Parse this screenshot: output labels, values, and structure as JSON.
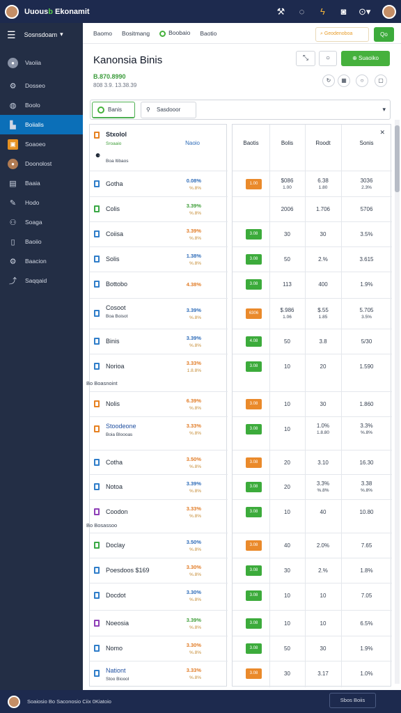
{
  "topbar": {
    "brand_prefix": "Uuous",
    "brand_accent": "b",
    "brand_rest": " Ekonamit"
  },
  "sidebar": {
    "header": "Sosnsdoam",
    "items": [
      {
        "label": "Vaoiia",
        "icon": "avatar-icon"
      },
      {
        "label": "Dosseo",
        "icon": "tools-icon"
      },
      {
        "label": "Boolo",
        "icon": "globe-icon"
      },
      {
        "label": "Boiialis",
        "icon": "chart-icon"
      },
      {
        "label": "Soaoeo",
        "icon": "box-icon"
      },
      {
        "label": "Doonolost",
        "icon": "person-icon"
      },
      {
        "label": "Baaia",
        "icon": "document-icon"
      },
      {
        "label": "Hodo",
        "icon": "pen-icon"
      },
      {
        "label": "Soaga",
        "icon": "users-icon"
      },
      {
        "label": "Baoiio",
        "icon": "copy-icon"
      },
      {
        "label": "Baacion",
        "icon": "settings-icon"
      },
      {
        "label": "Saqqaid",
        "icon": "share-icon"
      }
    ]
  },
  "main": {
    "tabs": [
      "Baomo",
      "Bositmang",
      "Boobaio",
      "Baotio"
    ],
    "search": "Geodenoboa",
    "go": "Qo",
    "title": "Kanonsia Binis",
    "sub1": "B.870.8990",
    "sub2": "808 3.9. 13.38.39",
    "add_label": "Suaoiko",
    "filters": [
      "Banis",
      "Sasdooor"
    ]
  },
  "left_panel": {
    "header_title": "Stxolol",
    "header_sub": "Sroaaio",
    "header_note": "Boa Itibaos",
    "header_col": "Naoio",
    "rows": [
      {
        "name": "Gotha",
        "p1": "0.08%",
        "p2": "%.8%"
      },
      {
        "name": "Colis",
        "p1": "3.39%",
        "p2": "%.8%"
      },
      {
        "name": "Coiisa",
        "p1": "3.39%",
        "p2": "%.8%"
      },
      {
        "name": "Solis",
        "p1": "1.38%",
        "p2": "%.8%"
      },
      {
        "name": "Bottobo",
        "p1": "4.38%",
        "p2": ""
      },
      {
        "name": "Cosoot",
        "sub": "Boa Boisot",
        "p1": "3.39%",
        "p2": "%.8%"
      },
      {
        "name": "Binis",
        "p1": "3.39%",
        "p2": "%.8%"
      },
      {
        "name": "Norioa",
        "p1": "3.33%",
        "p2": "1.8.8%"
      },
      {
        "name": "Nolis",
        "p1": "6.39%",
        "p2": "%.8%"
      },
      {
        "name": "Stoodeone",
        "sub": "Boia Bloooas",
        "p1": "3.33%",
        "p2": "%.8%"
      },
      {
        "name": "Cotha",
        "p1": "3.50%",
        "p2": "%.8%"
      },
      {
        "name": "Notoa",
        "p1": "3.39%",
        "p2": "%.8%"
      },
      {
        "name": "Coodon",
        "p1": "3.33%",
        "p2": "%.8%"
      },
      {
        "name": "Doclay",
        "p1": "3.50%",
        "p2": "%.8%"
      },
      {
        "name": "Poesdoos $169",
        "p1": "3.30%",
        "p2": "%.8%"
      },
      {
        "name": "Docdot",
        "p1": "3.30%",
        "p2": "%.8%"
      },
      {
        "name": "Noeosia",
        "p1": "3.39%",
        "p2": "%.8%"
      },
      {
        "name": "Nomo",
        "p1": "3.30%",
        "p2": "%.8%"
      },
      {
        "name": "Nationt",
        "sub": "Stoo Bioool",
        "p1": "3.33%",
        "p2": "%.8%"
      }
    ],
    "groups": [
      "Bo Boasnoint",
      "Bo Bosassoo"
    ]
  },
  "right_panel": {
    "headers": [
      "Baotis",
      "Bolis",
      "Roodt",
      "Sonis"
    ],
    "rows": [
      {
        "badge": "1.00",
        "c1": "$086",
        "c1b": "1.00",
        "c2": "6.38",
        "c2b": "1.80",
        "c3": "3036",
        "c3b": "2.3%"
      },
      {
        "badge": "",
        "c1": "2006",
        "c2": "1.706",
        "c3": "5706"
      },
      {
        "badge": "3.08",
        "c1": "30",
        "c2": "30",
        "c3": "3.5%"
      },
      {
        "badge": "3.08",
        "c1": "50",
        "c2": "2.%",
        "c3": "3.615"
      },
      {
        "badge": "3.08",
        "c1": "113",
        "c2": "400",
        "c3": "1.9%"
      },
      {
        "badge": "6306",
        "c1": "$.986",
        "c1b": "1.06",
        "c2": "$.55",
        "c2b": "1.85",
        "c3": "5.705",
        "c3b": "3.5%"
      },
      {
        "badge": "4.08",
        "c1": "50",
        "c2": "3.8",
        "c3": "5/30"
      },
      {
        "badge": "3.08",
        "c1": "10",
        "c2": "20",
        "c3": "1.590"
      },
      {
        "badge": "3.08",
        "c1": "10",
        "c2": "30",
        "c3": "1.860"
      },
      {
        "badge": "3.08",
        "c1": "10",
        "c2": "1.0%",
        "c2b": "1.8.80",
        "c3": "3.3%",
        "c3b": "%.8%"
      },
      {
        "badge": "3.08",
        "c1": "20",
        "c2": "3.10",
        "c3": "16.30"
      },
      {
        "badge": "3.08",
        "c1": "20",
        "c2": "3.3%",
        "c2b": "%.8%",
        "c3": "3.38",
        "c3b": "%.8%"
      },
      {
        "badge": "3.08",
        "c1": "10",
        "c2": "40",
        "c3": "10.80"
      },
      {
        "badge": "3.08",
        "c1": "40",
        "c2": "2.0%",
        "c3": "7.65"
      },
      {
        "badge": "3.08",
        "c1": "30",
        "c2": "2.%",
        "c3": "1.8%"
      },
      {
        "badge": "3.08",
        "c1": "10",
        "c2": "10",
        "c3": "7.05"
      },
      {
        "badge": "3.08",
        "c1": "10",
        "c2": "10",
        "c3": "6.5%"
      },
      {
        "badge": "3.08",
        "c1": "50",
        "c2": "30",
        "c3": "1.9%"
      },
      {
        "badge": "3.08",
        "c1": "30",
        "c2": "3.17",
        "c3": "1.0%"
      }
    ]
  },
  "footer": {
    "text": "Soaiosio Bo Saconosio Ciix 0Kiatoio",
    "button": "Sbos Boiis"
  }
}
